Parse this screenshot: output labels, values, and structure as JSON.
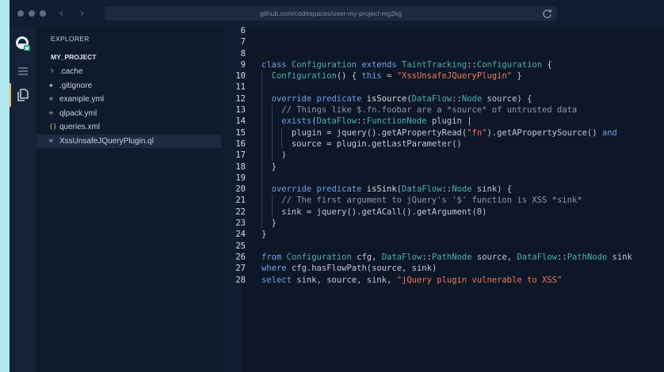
{
  "browser": {
    "url": "github.com/codespaces/user-my-project-mg2kg"
  },
  "activity_bar": {
    "items": [
      {
        "icon": "github-copilot-icon"
      },
      {
        "icon": "menu-icon"
      },
      {
        "icon": "files-icon"
      }
    ]
  },
  "sidebar": {
    "title": "EXPLORER",
    "project": "MY_PROJECT",
    "files": [
      {
        "icon": "chevron-right-icon",
        "glyph": "›",
        "label": ".cache"
      },
      {
        "icon": "gear-icon",
        "glyph": "◆",
        "label": ".gitignore"
      },
      {
        "icon": "lines-icon",
        "glyph": "≡",
        "label": "example.yml"
      },
      {
        "icon": "lines-icon",
        "glyph": "≡",
        "label": "qlpack.yml"
      },
      {
        "icon": "braces-icon",
        "glyph": "{}",
        "label": "queries.xml"
      },
      {
        "icon": "lines-icon",
        "glyph": "≡",
        "label": "XssUnsafeJQueryPlugin.ql",
        "active": true
      }
    ]
  },
  "editor": {
    "lines": [
      {
        "n": "6",
        "tokens": []
      },
      {
        "n": "7",
        "tokens": []
      },
      {
        "n": "8",
        "tokens": []
      },
      {
        "n": "9",
        "tokens": [
          [
            "kw",
            "class "
          ],
          [
            "ty",
            "Configuration "
          ],
          [
            "kw",
            "extends "
          ],
          [
            "ty",
            "TaintTracking"
          ],
          [
            "",
            "::"
          ],
          [
            "ty",
            "Configuration"
          ],
          [
            "",
            " {"
          ]
        ]
      },
      {
        "n": "10",
        "indent": 1,
        "tokens": [
          [
            "ty",
            "Configuration"
          ],
          [
            "",
            "() { "
          ],
          [
            "kw",
            "this"
          ],
          [
            "",
            " = "
          ],
          [
            "str",
            "\"XssUnsafeJQueryPlugin\""
          ],
          [
            "",
            " }"
          ]
        ]
      },
      {
        "n": "11",
        "indent": 1,
        "tokens": []
      },
      {
        "n": "12",
        "indent": 1,
        "tokens": [
          [
            "kw",
            "override predicate "
          ],
          [
            "fn",
            "isSource"
          ],
          [
            "",
            "("
          ],
          [
            "ty",
            "DataFlow"
          ],
          [
            "",
            "::"
          ],
          [
            "ty",
            "Node"
          ],
          [
            "",
            " source) {"
          ]
        ]
      },
      {
        "n": "13",
        "indent": 2,
        "tokens": [
          [
            "cm",
            "// Things like $.fn.foobar are a *source* of untrusted data"
          ]
        ]
      },
      {
        "n": "14",
        "indent": 2,
        "tokens": [
          [
            "kw",
            "exists"
          ],
          [
            "",
            "("
          ],
          [
            "ty",
            "DataFlow"
          ],
          [
            "",
            "::"
          ],
          [
            "ty",
            "FunctionNode"
          ],
          [
            "",
            " plugin |"
          ]
        ]
      },
      {
        "n": "15",
        "indent": 3,
        "tokens": [
          [
            "",
            "plugin = jquery().getAPropertyRead("
          ],
          [
            "str",
            "\"fn\""
          ],
          [
            "",
            ").getAPropertySource() "
          ],
          [
            "kw",
            "and"
          ]
        ]
      },
      {
        "n": "16",
        "indent": 3,
        "tokens": [
          [
            "",
            "source = plugin.getLastParameter()"
          ]
        ]
      },
      {
        "n": "17",
        "indent": 2,
        "tokens": [
          [
            "",
            ")"
          ]
        ]
      },
      {
        "n": "18",
        "indent": 1,
        "tokens": [
          [
            "",
            "}"
          ]
        ]
      },
      {
        "n": "19",
        "indent": 1,
        "tokens": []
      },
      {
        "n": "20",
        "indent": 1,
        "tokens": [
          [
            "kw",
            "override predicate "
          ],
          [
            "fn",
            "isSink"
          ],
          [
            "",
            "("
          ],
          [
            "ty",
            "DataFlow"
          ],
          [
            "",
            "::"
          ],
          [
            "ty",
            "Node"
          ],
          [
            "",
            " sink) {"
          ]
        ]
      },
      {
        "n": "21",
        "indent": 2,
        "tokens": [
          [
            "cm",
            "// The first argument to jQuery's '$' function is XSS *sink*"
          ]
        ]
      },
      {
        "n": "22",
        "indent": 2,
        "tokens": [
          [
            "",
            "sink = jquery().getACall().getArgument(0)"
          ]
        ]
      },
      {
        "n": "23",
        "indent": 1,
        "tokens": [
          [
            "",
            "}"
          ]
        ]
      },
      {
        "n": "24",
        "tokens": [
          [
            "",
            "}"
          ]
        ]
      },
      {
        "n": "25",
        "tokens": []
      },
      {
        "n": "26",
        "tokens": [
          [
            "kw",
            "from "
          ],
          [
            "ty",
            "Configuration "
          ],
          [
            "",
            "cfg, "
          ],
          [
            "ty",
            "DataFlow"
          ],
          [
            "",
            "::"
          ],
          [
            "ty",
            "PathNode "
          ],
          [
            "",
            "source, "
          ],
          [
            "ty",
            "DataFlow"
          ],
          [
            "",
            "::"
          ],
          [
            "ty",
            "PathNode "
          ],
          [
            "",
            "sink"
          ]
        ]
      },
      {
        "n": "27",
        "tokens": [
          [
            "kw",
            "where "
          ],
          [
            "",
            "cfg.hasFlowPath(source, sink)"
          ]
        ]
      },
      {
        "n": "28",
        "tokens": [
          [
            "kw",
            "select "
          ],
          [
            "",
            "sink, source, sink, "
          ],
          [
            "str",
            "\"jQuery plugin vulnerable to XSS\""
          ]
        ]
      }
    ]
  }
}
